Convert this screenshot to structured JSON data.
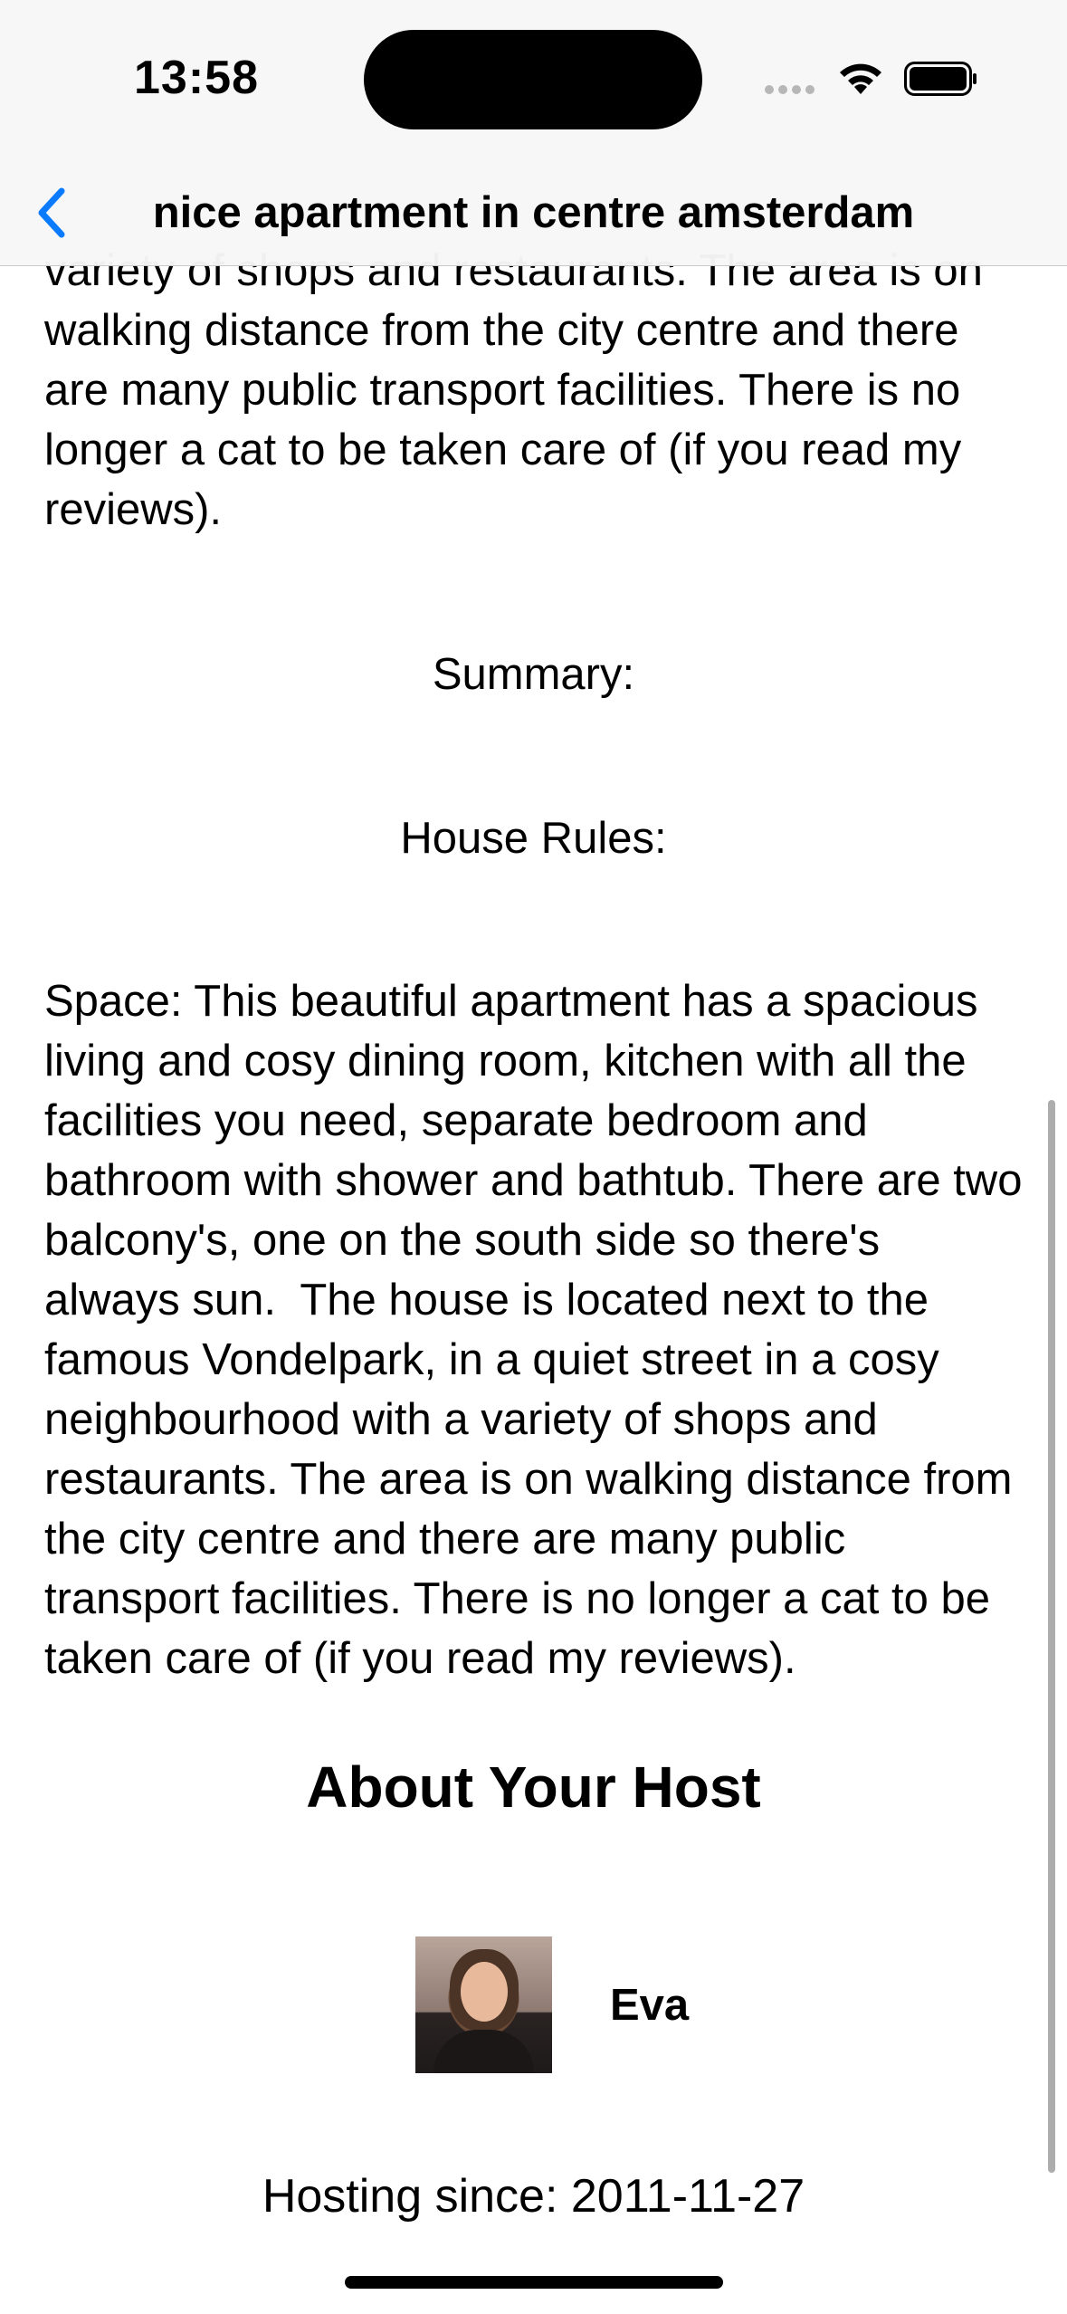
{
  "status_bar": {
    "time": "13:58"
  },
  "nav": {
    "title": "nice apartment in centre amsterdam",
    "back_icon": "chevron-left-icon",
    "accent_color": "#0a7aff"
  },
  "listing": {
    "top_paragraph": "variety of shops and restaurants. The area is on walking distance from the city centre and there are many public transport facilities. There is no longer a cat to be taken care of (if you read my reviews).",
    "summary_label": "Summary:",
    "house_rules_label": "House Rules:",
    "space_text": "Space: This beautiful apartment has a spacious living and cosy dining room, kitchen with all the facilities you need, separate bedroom and bathroom with shower and bathtub. There are two balcony's, one on the south side so there's always sun.  The house is located next to the famous Vondelpark, in a quiet street in a cosy neighbourhood with a variety of shops and restaurants. The area is on walking distance from the city centre and there are many public transport facilities. There is no longer a cat to be taken care of (if you read my reviews)."
  },
  "host": {
    "heading": "About Your Host",
    "name": "Eva",
    "hosting_since": "Hosting since: 2011-11-27"
  }
}
